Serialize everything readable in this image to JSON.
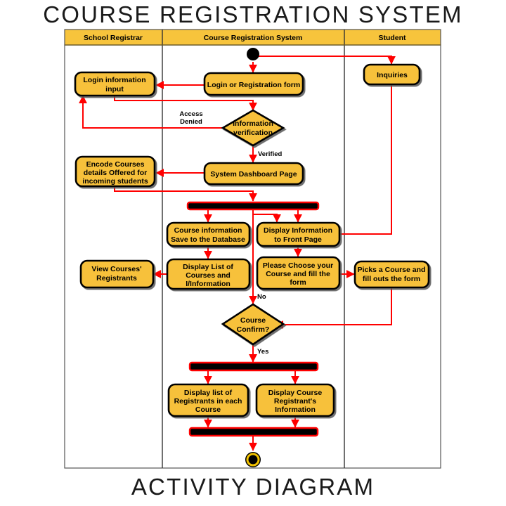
{
  "titles": {
    "top": "COURSE REGISTRATION SYSTEM",
    "bottom": "ACTIVITY DIAGRAM"
  },
  "colors": {
    "node_fill": "#F7C13B",
    "node_stroke": "#000000",
    "header_fill": "#F7C43C",
    "arrow": "#FF0000",
    "lane_divider": "#333333",
    "bar_fill": "#000000",
    "bar_stroke": "#FF0000",
    "end_ring": "#F2C200"
  },
  "lanes": [
    {
      "id": "lane-school-registrar",
      "label": "School Registrar"
    },
    {
      "id": "lane-course-registration-system",
      "label": "Course Registration System"
    },
    {
      "id": "lane-student",
      "label": "Student"
    }
  ],
  "nodes": [
    {
      "id": "start-node",
      "type": "initial",
      "lane": "lane-course-registration-system",
      "label": ""
    },
    {
      "id": "login-or-registration-form",
      "type": "action",
      "lane": "lane-course-registration-system",
      "label": "Login or Registration form"
    },
    {
      "id": "login-information-input",
      "type": "action",
      "lane": "lane-school-registrar",
      "label": "Login information input"
    },
    {
      "id": "inquiries",
      "type": "action",
      "lane": "lane-student",
      "label": "Inquiries"
    },
    {
      "id": "information-verification",
      "type": "decision",
      "lane": "lane-course-registration-system",
      "label": "Information verification"
    },
    {
      "id": "system-dashboard-page",
      "type": "action",
      "lane": "lane-course-registration-system",
      "label": "System Dashboard Page"
    },
    {
      "id": "encode-courses-details",
      "type": "action",
      "lane": "lane-school-registrar",
      "label": "Encode Courses details Offered for incoming students"
    },
    {
      "id": "fork-bar-1",
      "type": "fork",
      "lane": "lane-course-registration-system",
      "label": ""
    },
    {
      "id": "course-information-save",
      "type": "action",
      "lane": "lane-course-registration-system",
      "label": "Course information Save to the Database"
    },
    {
      "id": "display-information-front-page",
      "type": "action",
      "lane": "lane-course-registration-system",
      "label": "Display Information to Front Page"
    },
    {
      "id": "display-list-of-courses",
      "type": "action",
      "lane": "lane-course-registration-system",
      "label": "Display List of Courses and I/Information"
    },
    {
      "id": "please-choose-your-course",
      "type": "action",
      "lane": "lane-course-registration-system",
      "label": "Please Choose your Course and fill the form"
    },
    {
      "id": "view-courses-registrants",
      "type": "action",
      "lane": "lane-school-registrar",
      "label": "View Courses' Registrants"
    },
    {
      "id": "picks-a-course",
      "type": "action",
      "lane": "lane-student",
      "label": "Picks a Course and fill outs the form"
    },
    {
      "id": "course-confirm",
      "type": "decision",
      "lane": "lane-course-registration-system",
      "label": "Course Confirm?"
    },
    {
      "id": "fork-bar-2",
      "type": "fork",
      "lane": "lane-course-registration-system",
      "label": ""
    },
    {
      "id": "display-list-registrants-each-course",
      "type": "action",
      "lane": "lane-course-registration-system",
      "label": "Display list of Registrants in each Course"
    },
    {
      "id": "display-course-registrant-information",
      "type": "action",
      "lane": "lane-course-registration-system",
      "label": "Display Course Registrant's Information"
    },
    {
      "id": "join-bar",
      "type": "join",
      "lane": "lane-course-registration-system",
      "label": ""
    },
    {
      "id": "end-node",
      "type": "final",
      "lane": "lane-course-registration-system",
      "label": ""
    }
  ],
  "node_text_lines": {
    "login-or-registration-form": [
      "Login or Registration form"
    ],
    "login-information-input": [
      "Login information",
      "input"
    ],
    "inquiries": [
      "Inquiries"
    ],
    "information-verification": [
      "Information",
      "verification"
    ],
    "system-dashboard-page": [
      "System Dashboard Page"
    ],
    "encode-courses-details": [
      "Encode Courses",
      "details Offered for",
      "incoming students"
    ],
    "course-information-save": [
      "Course information",
      "Save to the Database"
    ],
    "display-information-front-page": [
      "Display Information",
      "to Front Page"
    ],
    "display-list-of-courses": [
      "Display List of",
      "Courses and",
      "I/Information"
    ],
    "please-choose-your-course": [
      "Please Choose your",
      "Course and fill the",
      "form"
    ],
    "view-courses-registrants": [
      "View Courses'",
      "Registrants"
    ],
    "picks-a-course": [
      "Picks a Course and",
      "fill outs the form"
    ],
    "course-confirm": [
      "Course",
      "Confirm?"
    ],
    "display-list-registrants-each-course": [
      "Display list of",
      "Registrants in each",
      "Course"
    ],
    "display-course-registrant-information": [
      "Display Course",
      "Registrant's",
      "Information"
    ]
  },
  "guards": [
    {
      "id": "guard-access-denied",
      "lines": [
        "Access",
        "Denied"
      ]
    },
    {
      "id": "guard-verified",
      "lines": [
        "Verified"
      ]
    },
    {
      "id": "guard-no",
      "lines": [
        "No"
      ]
    },
    {
      "id": "guard-yes",
      "lines": [
        "Yes"
      ]
    }
  ]
}
